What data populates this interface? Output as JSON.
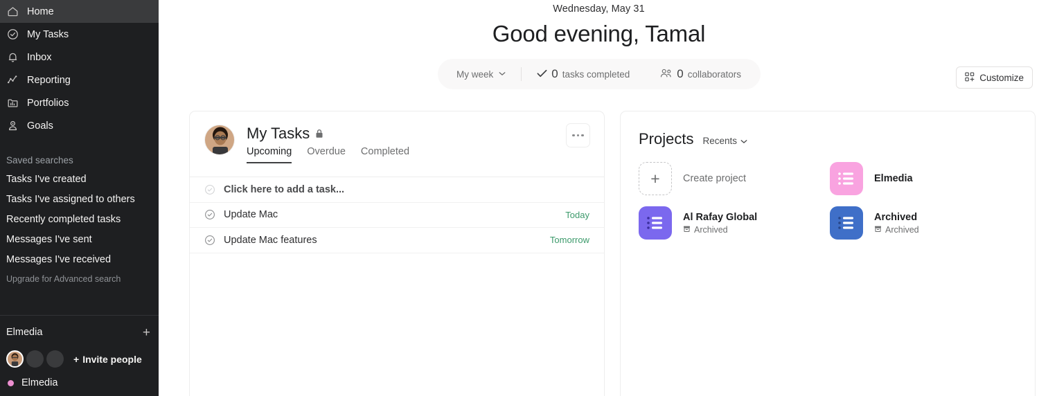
{
  "sidebar": {
    "nav": [
      {
        "label": "Home",
        "icon": "home-icon",
        "active": true
      },
      {
        "label": "My Tasks",
        "icon": "check-circle-icon",
        "active": false
      },
      {
        "label": "Inbox",
        "icon": "bell-icon",
        "active": false
      },
      {
        "label": "Reporting",
        "icon": "chart-line-icon",
        "active": false
      },
      {
        "label": "Portfolios",
        "icon": "portfolio-icon",
        "active": false
      },
      {
        "label": "Goals",
        "icon": "goal-person-icon",
        "active": false
      }
    ],
    "saved_searches_heading": "Saved searches",
    "saved_searches": [
      {
        "label": "Tasks I've created"
      },
      {
        "label": "Tasks I've assigned to others"
      },
      {
        "label": "Recently completed tasks"
      },
      {
        "label": "Messages I've sent"
      },
      {
        "label": "Messages I've received"
      }
    ],
    "upgrade_label": "Upgrade for Advanced search",
    "team": {
      "name": "Elmedia",
      "add_label": "+",
      "invite_label": "Invite people",
      "invite_plus": "+",
      "project": {
        "label": "Elmedia",
        "color": "#ec8fd0"
      }
    }
  },
  "header": {
    "date": "Wednesday, May 31",
    "greeting": "Good evening, Tamal",
    "stats": {
      "range_label": "My week",
      "tasks_completed_count": "0",
      "tasks_completed_label": "tasks completed",
      "collaborators_count": "0",
      "collaborators_label": "collaborators"
    },
    "customize_label": "Customize"
  },
  "my_tasks": {
    "title": "My Tasks",
    "privacy": "lock-icon",
    "tabs": [
      {
        "label": "Upcoming",
        "active": true
      },
      {
        "label": "Overdue",
        "active": false
      },
      {
        "label": "Completed",
        "active": false
      }
    ],
    "add_task_placeholder": "Click here to add a task...",
    "rows": [
      {
        "title": "Update Mac",
        "due": "Today"
      },
      {
        "title": "Update Mac features",
        "due": "Tomorrow"
      }
    ],
    "due_color": "#3c9a6b"
  },
  "projects": {
    "title": "Projects",
    "filter_label": "Recents",
    "items": [
      {
        "name": "Create project",
        "sub": "",
        "color": "",
        "type": "create"
      },
      {
        "name": "Elmedia",
        "sub": "",
        "color": "#f9a3e0",
        "type": "project"
      },
      {
        "name": "Al Rafay Global",
        "sub": "Archived",
        "color": "#7b68ee",
        "type": "project"
      },
      {
        "name": "Archived",
        "sub": "Archived",
        "color": "#3f6fc8",
        "type": "project"
      }
    ]
  }
}
